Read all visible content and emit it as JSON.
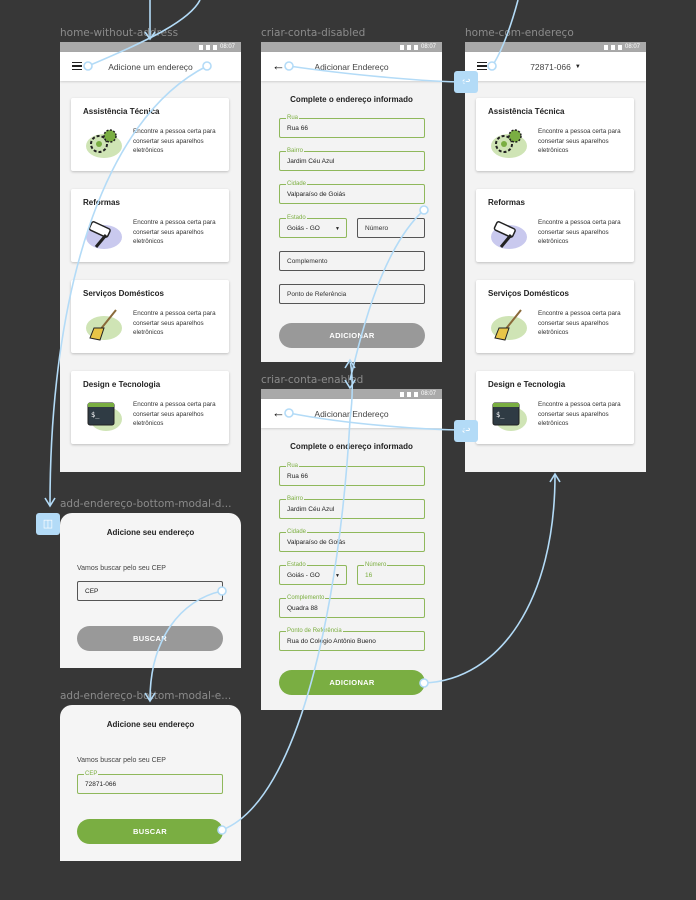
{
  "status_time": "08:07",
  "frames": {
    "home_without_address": "home-without-address",
    "criar_conta_disabled": "criar-conta-disabled",
    "home_com_endereco": "home-com-endereço",
    "criar_conta_enabled": "criar-conta-enabled",
    "modal_d": "add-endereço-bottom-modal-d...",
    "modal_e": "add-endereço-bottom-modal-e..."
  },
  "home1": {
    "appbar_title": "Adicione um endereço"
  },
  "home2": {
    "appbar_title": "72871-066"
  },
  "services": [
    {
      "title": "Assistência Técnica",
      "desc": "Encontre a pessoa certa para consertar seus aparelhos eletrônicos",
      "icon": "gears-icon"
    },
    {
      "title": "Reformas",
      "desc": "Encontre a pessoa certa para consertar seus aparelhos eletrônicos",
      "icon": "paint-roller-icon"
    },
    {
      "title": "Serviços Domésticos",
      "desc": "Encontre a pessoa certa para consertar seus aparelhos eletrônicos",
      "icon": "broom-icon"
    },
    {
      "title": "Design e Tecnologia",
      "desc": "Encontre a pessoa certa para consertar seus aparelhos eletrônicos",
      "icon": "terminal-icon"
    }
  ],
  "form": {
    "appbar_title": "Adicionar Endereço",
    "heading": "Complete o endereço informado",
    "labels": {
      "rua": "Rua",
      "bairro": "Bairro",
      "cidade": "Cidade",
      "estado": "Estado",
      "numero": "Número",
      "complemento": "Complemento",
      "referencia": "Ponto de Referência"
    },
    "disabled": {
      "rua": "Rua 66",
      "bairro": "Jardim Céu Azul",
      "cidade": "Valparaíso de Goiás",
      "estado": "Goiás - GO",
      "numero_placeholder": "Número",
      "complemento_placeholder": "Complemento",
      "referencia_placeholder": "Ponto de Referência",
      "button": "ADICIONAR"
    },
    "enabled": {
      "rua": "Rua 66",
      "bairro": "Jardim Céu Azul",
      "cidade": "Valparaíso de Goiás",
      "estado": "Goiás - GO",
      "numero": "16",
      "complemento": "Quadra 88",
      "referencia": "Rua do Colégio Antônio Bueno",
      "button": "ADICIONAR"
    }
  },
  "modal": {
    "title": "Adicione seu endereço",
    "subtitle": "Vamos buscar pelo seu CEP",
    "cep_label": "CEP",
    "cep_placeholder": "CEP",
    "cep_value": "72871-066",
    "button": "BUSCAR"
  },
  "colors": {
    "accent": "#7aae42",
    "disabled": "#999999",
    "wire": "#b3dbf7",
    "canvas": "#373737"
  }
}
